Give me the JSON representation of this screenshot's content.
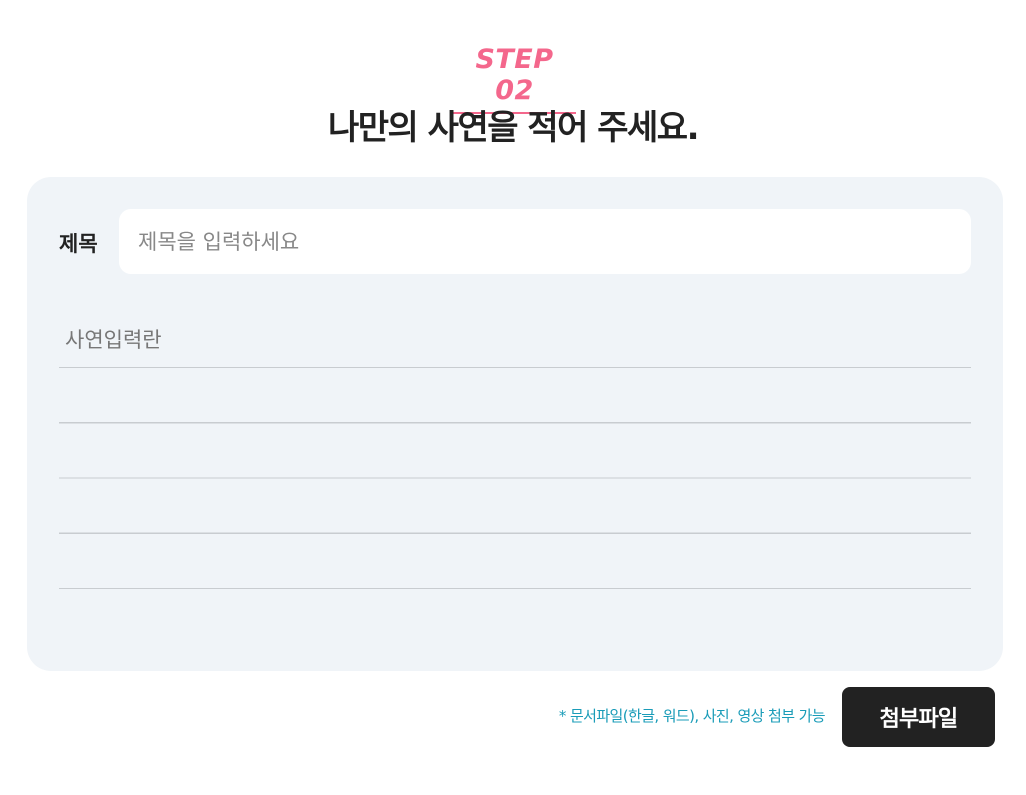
{
  "step": {
    "label": "STEP 02",
    "heading": "나만의 사연을 적어 주세요."
  },
  "form": {
    "title_label": "제목",
    "title_placeholder": "제목을 입력하세요",
    "title_value": "",
    "story_placeholder": "사연입력란",
    "story_value": ""
  },
  "attachment": {
    "notice": "* 문서파일(한글, 워드), 사진, 영상 첨부 가능",
    "button_label": "첨부파일"
  },
  "colors": {
    "accent_pink": "#f4678c",
    "notice_blue": "#1a9cb8",
    "card_background": "#f0f4f8",
    "button_background": "#222222"
  }
}
